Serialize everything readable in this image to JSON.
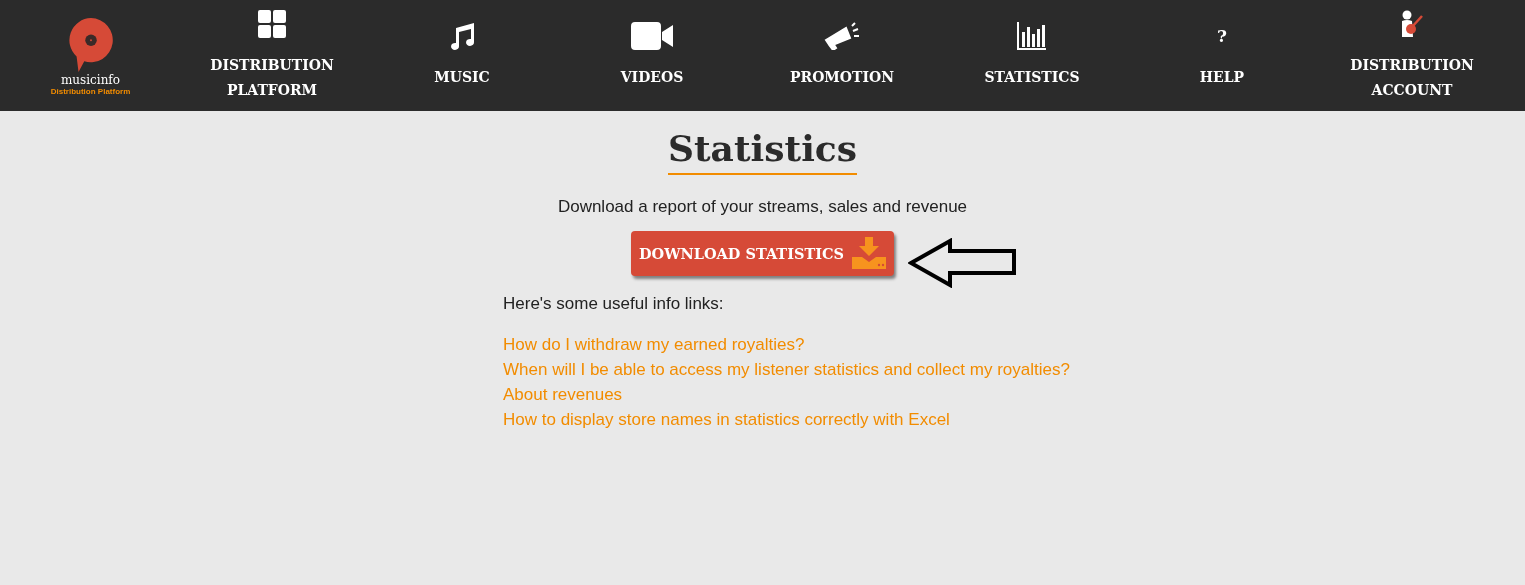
{
  "logo": {
    "name": "musicinfo",
    "tagline": "Distribution Platform"
  },
  "nav": [
    {
      "kind": "grid",
      "label": "DISTRIBUTION PLATFORM"
    },
    {
      "kind": "note",
      "label": "MUSIC"
    },
    {
      "kind": "video",
      "label": "VIDEOS"
    },
    {
      "kind": "megaphone",
      "label": "PROMOTION"
    },
    {
      "kind": "bars",
      "label": "STATISTICS"
    },
    {
      "kind": "help",
      "label": "HELP",
      "glyph": "?"
    },
    {
      "kind": "guitarist",
      "label": "DISTRIBUTION ACCOUNT"
    }
  ],
  "page": {
    "title": "Statistics",
    "subtitle": "Download a report of your streams, sales and revenue",
    "download_button": "DOWNLOAD STATISTICS",
    "links_intro": "Here's some useful info links:",
    "links": [
      "How do I withdraw my earned royalties?",
      "When will I be able to access my listener statistics and collect my royalties?",
      "About revenues",
      "How to display store names in statistics correctly with Excel"
    ]
  }
}
